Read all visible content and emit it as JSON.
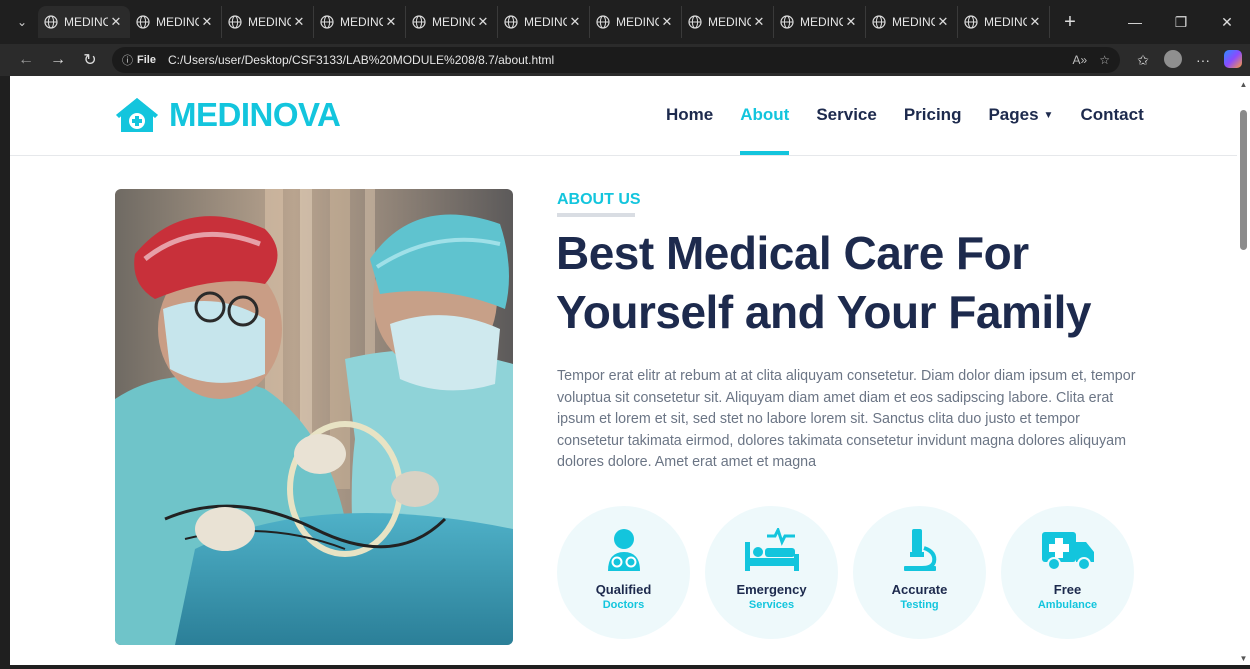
{
  "browser": {
    "tabs": [
      {
        "label": "MEDINOVA",
        "active": true
      },
      {
        "label": "MEDINOVA"
      },
      {
        "label": "MEDINOVA"
      },
      {
        "label": "MEDINOVA"
      },
      {
        "label": "MEDINOVA"
      },
      {
        "label": "MEDINOVA"
      },
      {
        "label": "MEDINOVA"
      },
      {
        "label": "MEDINOVA"
      },
      {
        "label": "MEDINOVA"
      },
      {
        "label": "MEDINOVA"
      },
      {
        "label": "MEDINOVA"
      }
    ],
    "address": {
      "scheme_label": "File",
      "url": "C:/Users/user/Desktop/CSF3133/LAB%20MODULE%208/8.7/about.html"
    }
  },
  "site": {
    "brand": "MEDINOVA",
    "nav": [
      {
        "label": "Home"
      },
      {
        "label": "About",
        "active": true
      },
      {
        "label": "Service"
      },
      {
        "label": "Pricing"
      },
      {
        "label": "Pages"
      },
      {
        "label": "Contact"
      }
    ]
  },
  "about": {
    "label": "ABOUT US",
    "headline_line1": "Best Medical Care For",
    "headline_line2": "Yourself and Your Family",
    "description": "Tempor erat elitr at rebum at at clita aliquyam consetetur. Diam dolor diam ipsum et, tempor voluptua sit consetetur sit. Aliquyam diam amet diam et eos sadipscing labore. Clita erat ipsum et lorem et sit, sed stet no labore lorem sit. Sanctus clita duo justo et tempor consetetur takimata eirmod, dolores takimata consetetur invidunt magna dolores aliquyam dolores dolore. Amet erat amet et magna",
    "features": [
      {
        "title": "Qualified",
        "subtitle": "Doctors",
        "icon": "doctor-icon"
      },
      {
        "title": "Emergency",
        "subtitle": "Services",
        "icon": "procedures-icon"
      },
      {
        "title": "Accurate",
        "subtitle": "Testing",
        "icon": "microscope-icon"
      },
      {
        "title": "Free",
        "subtitle": "Ambulance",
        "icon": "ambulance-icon"
      }
    ]
  },
  "colors": {
    "primary": "#13c5dd",
    "dark": "#1d2a4d",
    "text": "#6b7585",
    "feature_bg": "#eef9fb"
  }
}
